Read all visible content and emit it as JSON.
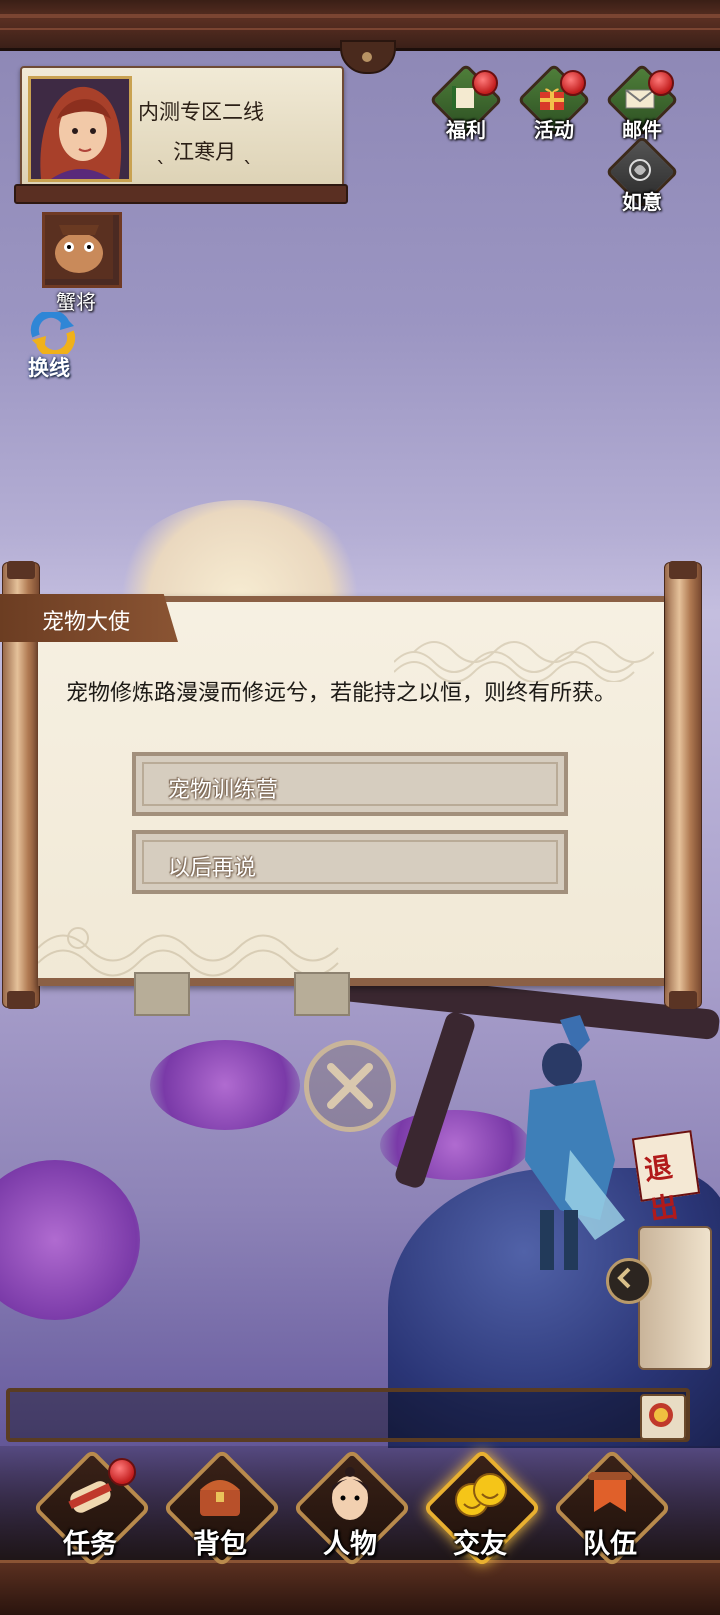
{
  "player": {
    "server": "内测专区二线",
    "name": "ˎ 江寒月 ˎ"
  },
  "pet": {
    "label": "蟹将"
  },
  "swap_line": {
    "label": "换线"
  },
  "top_menu": [
    {
      "label": "福利",
      "icon": "welfare-icon",
      "badge": true
    },
    {
      "label": "活动",
      "icon": "gift-icon",
      "badge": true
    },
    {
      "label": "邮件",
      "icon": "mail-icon",
      "badge": true
    },
    {
      "label": "如意",
      "icon": "ruyi-icon",
      "badge": false
    }
  ],
  "dialog": {
    "title": "宠物大使",
    "text": "宠物修炼路漫漫而修远兮，若能持之以恒，则终有所获。",
    "options": [
      {
        "label": "宠物训练营"
      },
      {
        "label": "以后再说"
      }
    ]
  },
  "exit_badge": {
    "label": "退出"
  },
  "bottom_nav": [
    {
      "label": "任务",
      "icon": "scroll-icon",
      "badge": true
    },
    {
      "label": "背包",
      "icon": "chest-icon",
      "badge": false
    },
    {
      "label": "人物",
      "icon": "character-icon",
      "badge": false
    },
    {
      "label": "交友",
      "icon": "smiley-icon",
      "badge": false
    },
    {
      "label": "队伍",
      "icon": "banner-icon",
      "badge": false
    }
  ],
  "colors": {
    "badge_red": "#c21d1d",
    "frame_brown": "#5a2f22",
    "paper": "#f6f0e2",
    "button_beige": "#d6cdbf"
  }
}
